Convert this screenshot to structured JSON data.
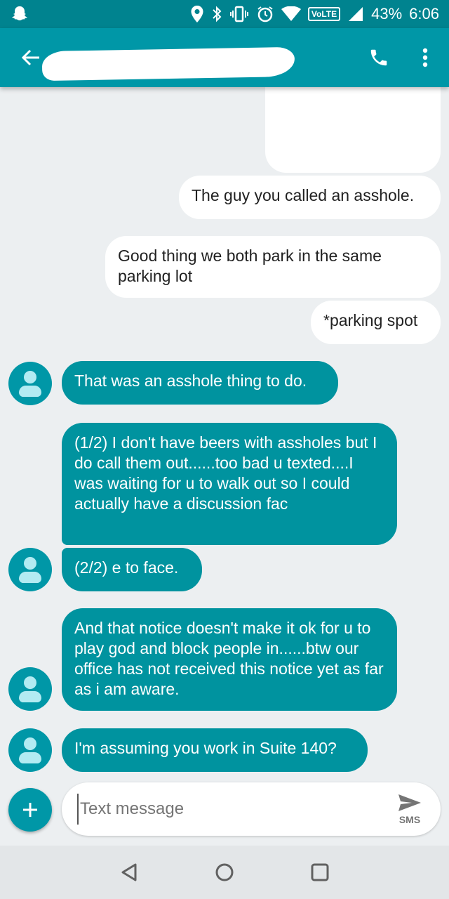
{
  "status_bar": {
    "battery": "43%",
    "time": "6:06",
    "network_badge": "VoLTE",
    "icons": [
      "snapchat-ghost-icon",
      "location-icon",
      "bluetooth-icon",
      "vibrate-icon",
      "alarm-icon",
      "wifi-icon",
      "signal-icon"
    ]
  },
  "app_bar": {
    "contact_name": "",
    "icons": [
      "back-arrow-icon",
      "phone-icon",
      "more-vert-icon"
    ]
  },
  "messages": [
    {
      "direction": "out",
      "text": ""
    },
    {
      "direction": "out",
      "text": "The guy you called an asshole."
    },
    {
      "direction": "out",
      "text": "Good thing we both park in the same parking lot"
    },
    {
      "direction": "out",
      "text": "*parking spot"
    },
    {
      "direction": "in",
      "text": "That was an asshole thing to do."
    },
    {
      "direction": "in",
      "text": "(1/2) I don't have beers with assholes but I do call them out......too bad u texted....I was waiting for u to walk out so I could actually have a discussion fac"
    },
    {
      "direction": "in",
      "text": "(2/2) e to face."
    },
    {
      "direction": "in",
      "text": "And that notice doesn't make it ok for u to play god and block people in......btw our office has not received this notice yet as far as i am aware."
    },
    {
      "direction": "in",
      "text": "I'm assuming you work in Suite 140?"
    }
  ],
  "compose": {
    "placeholder": "Text message",
    "value": "",
    "send_label": "SMS"
  },
  "colors": {
    "status_bar": "#00838f",
    "app_bar": "#0097a7",
    "incoming_bubble": "#00939f",
    "outgoing_bubble": "#ffffff",
    "background": "#eceff1"
  }
}
